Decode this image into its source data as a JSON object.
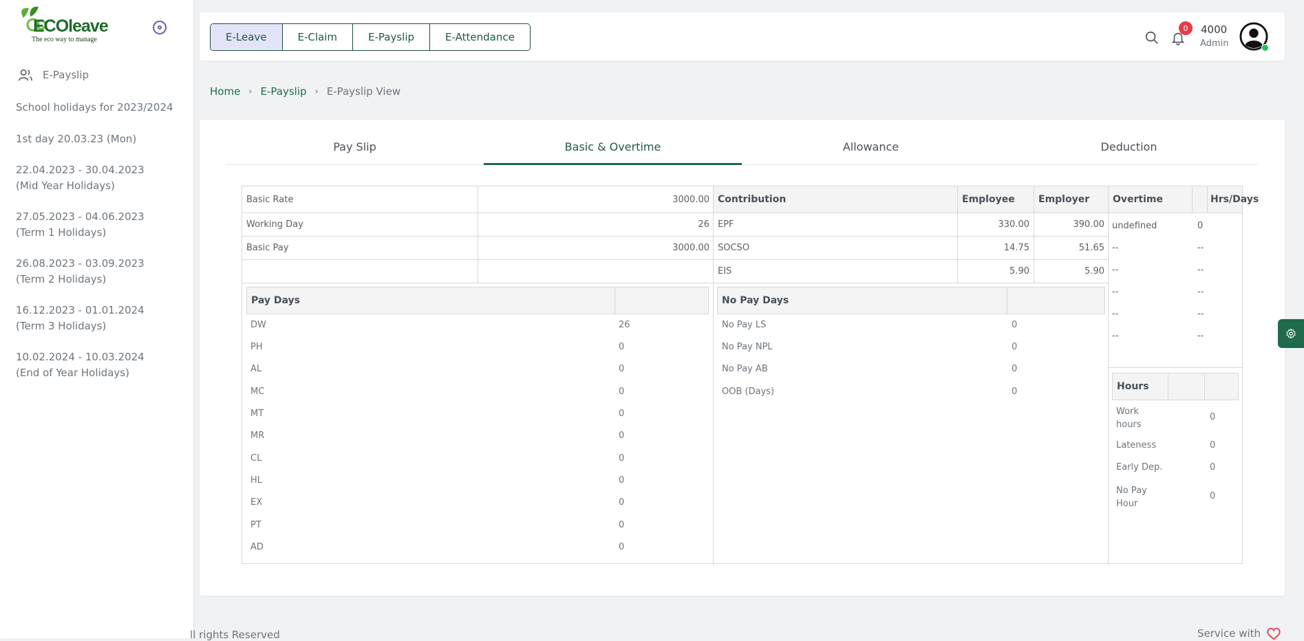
{
  "sidebar": {
    "logo_word": "ECOleave",
    "logo_tagline": "The eco way to manage",
    "menu_label": "E-Payslip",
    "items": [
      "School holidays for 2023/2024",
      "1st day 20.03.23 (Mon)",
      "22.04.2023 - 30.04.2023\n(Mid Year Holidays)",
      "27.05.2023 - 04.06.2023\n(Term 1 Holidays)",
      "26.08.2023 - 03.09.2023\n(Term 2 Holidays)",
      "16.12.2023 - 01.01.2024\n(Term 3 Holidays)",
      "10.02.2024 - 10.03.2024\n(End of Year Holidays)"
    ]
  },
  "header": {
    "tabs": [
      "E-Leave",
      "E-Claim",
      "E-Payslip",
      "E-Attendance"
    ],
    "notif_count": "0",
    "user_name": "4000",
    "user_role": "Admin"
  },
  "breadcrumb": {
    "home": "Home",
    "section": "E-Payslip",
    "current": "E-Payslip View"
  },
  "subtabs": [
    "Pay Slip",
    "Basic & Overtime",
    "Allowance",
    "Deduction"
  ],
  "basic": {
    "rows": [
      {
        "label": "Basic Rate",
        "value": "3000.00"
      },
      {
        "label": "Working Day",
        "value": "26"
      },
      {
        "label": "Basic Pay",
        "value": "3000.00"
      }
    ]
  },
  "contribution": {
    "headers": [
      "Contribution",
      "Employee",
      "Employer"
    ],
    "rows": [
      {
        "label": "EPF",
        "employee": "330.00",
        "employer": "390.00"
      },
      {
        "label": "SOCSO",
        "employee": "14.75",
        "employer": "51.65"
      },
      {
        "label": "EIS",
        "employee": "5.90",
        "employer": "5.90"
      }
    ]
  },
  "overtime": {
    "headers": [
      "Overtime",
      "Hrs/Days"
    ],
    "rows": [
      {
        "label": "undefined",
        "value": "0"
      },
      {
        "label": "--",
        "value": "--"
      },
      {
        "label": "--",
        "value": "--"
      },
      {
        "label": "--",
        "value": "--"
      },
      {
        "label": "--",
        "value": "--"
      },
      {
        "label": "--",
        "value": "--"
      }
    ]
  },
  "pay_days": {
    "header": "Pay Days",
    "rows": [
      {
        "label": "DW",
        "value": "26"
      },
      {
        "label": "PH",
        "value": "0"
      },
      {
        "label": "AL",
        "value": "0"
      },
      {
        "label": "MC",
        "value": "0"
      },
      {
        "label": "MT",
        "value": "0"
      },
      {
        "label": "MR",
        "value": "0"
      },
      {
        "label": "CL",
        "value": "0"
      },
      {
        "label": "HL",
        "value": "0"
      },
      {
        "label": "EX",
        "value": "0"
      },
      {
        "label": "PT",
        "value": "0"
      },
      {
        "label": "AD",
        "value": "0"
      }
    ]
  },
  "no_pay_days": {
    "header": "No Pay Days",
    "rows": [
      {
        "label": "No Pay LS",
        "value": "0"
      },
      {
        "label": "No Pay NPL",
        "value": "0"
      },
      {
        "label": "No Pay AB",
        "value": "0"
      },
      {
        "label": "OOB (Days)",
        "value": "0"
      }
    ]
  },
  "hours": {
    "header": "Hours",
    "rows": [
      {
        "label": "Work\nhours",
        "value": "0"
      },
      {
        "label": "Lateness",
        "value": "0"
      },
      {
        "label": "Early Dep.",
        "value": "0"
      },
      {
        "label": "No Pay\nHour",
        "value": "0"
      }
    ]
  },
  "footer": {
    "left": "ll rights Reserved",
    "right": "Service with"
  },
  "colors": {
    "brand_green": "#1f6b4b",
    "active_tab_bg": "#e3e3fa",
    "badge_red": "#e63b4a"
  }
}
